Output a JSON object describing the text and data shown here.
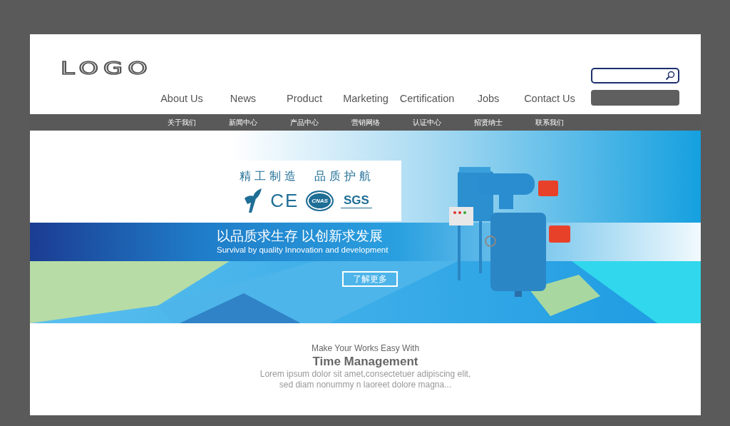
{
  "header": {
    "logo": "LOGO"
  },
  "nav": [
    {
      "label": "About Us",
      "sub": "关于我们"
    },
    {
      "label": "News",
      "sub": "新闻中心"
    },
    {
      "label": "Product",
      "sub": "产品中心"
    },
    {
      "label": "Marketing",
      "sub": "营销网络"
    },
    {
      "label": "Certification",
      "sub": "认证中心"
    },
    {
      "label": "Jobs",
      "sub": "招贤纳士"
    },
    {
      "label": "Contact Us",
      "sub": "联系我们"
    }
  ],
  "banner": {
    "slogan": "精工制造　品质护航",
    "cert_marks": [
      {
        "kind": "plain",
        "label": "CE"
      },
      {
        "kind": "oval",
        "label": "CNAS"
      },
      {
        "kind": "underlined",
        "label": "SGS"
      }
    ],
    "headline": "以品质求生存  以创新求发展",
    "subheadline": "Survival by quality  Innovation and development",
    "button": "了解更多"
  },
  "intro": {
    "kicker": "Make Your Works Easy With",
    "title": "Time Management",
    "body_lines": [
      "Lorem ipsum dolor sit amet,consectetuer adipiscing elit,",
      "sed diam nonummy n laoreet dolore magna..."
    ]
  }
}
